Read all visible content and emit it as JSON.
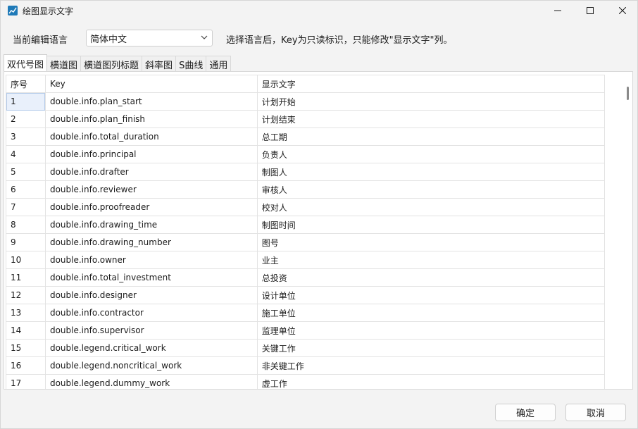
{
  "window": {
    "title": "绘图显示文字",
    "icon": "chart-line-icon"
  },
  "language": {
    "label": "当前编辑语言",
    "selected": "简体中文",
    "hint": "选择语言后，Key为只读标识，只能修改\"显示文字\"列。"
  },
  "tabs": [
    {
      "label": "双代号图",
      "active": true
    },
    {
      "label": "横道图",
      "active": false
    },
    {
      "label": "横道图列标题",
      "active": false
    },
    {
      "label": "斜率图",
      "active": false
    },
    {
      "label": "S曲线",
      "active": false
    },
    {
      "label": "通用",
      "active": false
    }
  ],
  "table": {
    "headers": [
      "序号",
      "Key",
      "显示文字"
    ],
    "rows": [
      [
        "1",
        "double.info.plan_start",
        "计划开始"
      ],
      [
        "2",
        "double.info.plan_finish",
        "计划结束"
      ],
      [
        "3",
        "double.info.total_duration",
        "总工期"
      ],
      [
        "4",
        "double.info.principal",
        "负责人"
      ],
      [
        "5",
        "double.info.drafter",
        "制图人"
      ],
      [
        "6",
        "double.info.reviewer",
        "审核人"
      ],
      [
        "7",
        "double.info.proofreader",
        "校对人"
      ],
      [
        "8",
        "double.info.drawing_time",
        "制图时间"
      ],
      [
        "9",
        "double.info.drawing_number",
        "图号"
      ],
      [
        "10",
        "double.info.owner",
        "业主"
      ],
      [
        "11",
        "double.info.total_investment",
        "总投资"
      ],
      [
        "12",
        "double.info.designer",
        "设计单位"
      ],
      [
        "13",
        "double.info.contractor",
        "施工单位"
      ],
      [
        "14",
        "double.info.supervisor",
        "监理单位"
      ],
      [
        "15",
        "double.legend.critical_work",
        "关键工作"
      ],
      [
        "16",
        "double.legend.noncritical_work",
        "非关键工作"
      ],
      [
        "17",
        "double.legend.dummy_work",
        "虚工作"
      ]
    ]
  },
  "footer": {
    "ok_label": "确定",
    "cancel_label": "取消"
  },
  "colors": {
    "selection": "#e9f0fb",
    "accent": "#1f7ab8"
  }
}
